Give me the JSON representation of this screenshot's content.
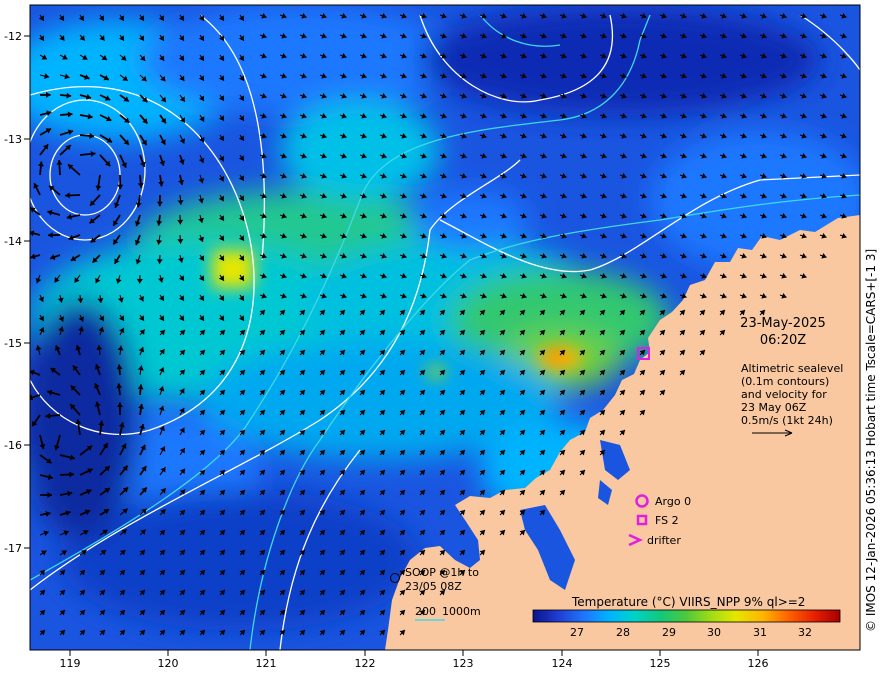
{
  "map": {
    "date": "23-May-2025",
    "time": "06:20Z",
    "legend_lines": [
      "Altimetric sealevel",
      "(0.1m contours)",
      "and velocity for",
      "23 May 06Z",
      "0.5m/s (1kt 24h)"
    ],
    "markers": {
      "argo": "Argo 0",
      "fs": "FS 2",
      "drifter": "drifter"
    },
    "soop": [
      "SOOP @1h to",
      "23/05 08Z"
    ],
    "depth_contours": [
      "200",
      "1000m"
    ],
    "credit": "© IMOS 12-Jan-2026 05:36:13 Hobart time Tscale=CARS+[-1 3]",
    "colorbar": {
      "title": "Temperature (°C) VIIRS_NPP 9% ql>=2",
      "ticks": [
        "27",
        "28",
        "29",
        "30",
        "31",
        "32"
      ],
      "colors": [
        "#0a148c",
        "#1e3cd2",
        "#1e78ff",
        "#00b4ff",
        "#00d2c8",
        "#14c878",
        "#50c83c",
        "#a0dc14",
        "#e6e600",
        "#ffb400",
        "#ff6400",
        "#e61e00",
        "#a50000"
      ]
    },
    "x_ticks": [
      "119",
      "120",
      "121",
      "122",
      "123",
      "124",
      "125",
      "126"
    ],
    "y_ticks": [
      "-12",
      "-13",
      "-14",
      "-15",
      "-16",
      "-17"
    ],
    "colors": {
      "land": "#f9c8a0",
      "argo": "#e020e0",
      "contour": "#ffffff",
      "isobath": "#40d8e8",
      "arrow": "#000000"
    }
  }
}
